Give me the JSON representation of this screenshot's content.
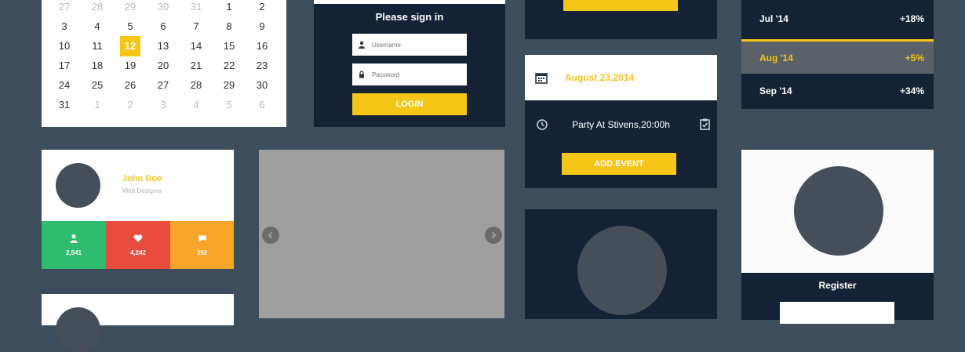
{
  "calendar": {
    "weeks": [
      [
        {
          "d": "27",
          "m": true
        },
        {
          "d": "28",
          "m": true
        },
        {
          "d": "29",
          "m": true
        },
        {
          "d": "30",
          "m": true
        },
        {
          "d": "31",
          "m": true
        },
        {
          "d": "1",
          "m": false
        },
        {
          "d": "2",
          "m": false
        }
      ],
      [
        {
          "d": "3",
          "m": false
        },
        {
          "d": "4",
          "m": false
        },
        {
          "d": "5",
          "m": false
        },
        {
          "d": "6",
          "m": false
        },
        {
          "d": "7",
          "m": false
        },
        {
          "d": "8",
          "m": false
        },
        {
          "d": "9",
          "m": false
        }
      ],
      [
        {
          "d": "10",
          "m": false
        },
        {
          "d": "11",
          "m": false
        },
        {
          "d": "12",
          "m": false,
          "today": true
        },
        {
          "d": "13",
          "m": false
        },
        {
          "d": "14",
          "m": false
        },
        {
          "d": "15",
          "m": false
        },
        {
          "d": "16",
          "m": false
        }
      ],
      [
        {
          "d": "17",
          "m": false
        },
        {
          "d": "18",
          "m": false
        },
        {
          "d": "19",
          "m": false
        },
        {
          "d": "20",
          "m": false
        },
        {
          "d": "21",
          "m": false
        },
        {
          "d": "22",
          "m": false
        },
        {
          "d": "23",
          "m": false
        }
      ],
      [
        {
          "d": "24",
          "m": false
        },
        {
          "d": "25",
          "m": false
        },
        {
          "d": "26",
          "m": false
        },
        {
          "d": "27",
          "m": false
        },
        {
          "d": "28",
          "m": false
        },
        {
          "d": "29",
          "m": false
        },
        {
          "d": "30",
          "m": false
        }
      ],
      [
        {
          "d": "31",
          "m": false
        },
        {
          "d": "1",
          "m": true
        },
        {
          "d": "2",
          "m": true
        },
        {
          "d": "3",
          "m": true
        },
        {
          "d": "4",
          "m": true
        },
        {
          "d": "5",
          "m": true
        },
        {
          "d": "6",
          "m": true
        }
      ]
    ]
  },
  "signin": {
    "title": "Please sign in",
    "username_placeholder": "Username",
    "password_placeholder": "Password",
    "login_label": "LOGIN",
    "username_icon": "user-icon",
    "password_icon": "lock-icon"
  },
  "stats": {
    "rows": [
      {
        "month": "Jul '14",
        "value": "+18%",
        "active": false
      },
      {
        "month": "Aug '14",
        "value": "+5%",
        "active": true
      },
      {
        "month": "Sep '14",
        "value": "+34%",
        "active": false
      }
    ]
  },
  "event": {
    "date": "August 23,2014",
    "title": "Party At Stivens,20:00h",
    "add_label": "ADD EVENT",
    "calendar_icon": "calendar-icon",
    "clock_icon": "clock-icon",
    "clipboard_icon": "clipboard-icon"
  },
  "profile": {
    "name": "John Doe",
    "role": "Web Designer",
    "stats": [
      {
        "icon": "user-icon",
        "value": "2,541",
        "color": "#2ebd6f"
      },
      {
        "icon": "heart-icon",
        "value": "4,242",
        "color": "#e84c3d"
      },
      {
        "icon": "comment-icon",
        "value": "392",
        "color": "#f7a62b"
      }
    ]
  },
  "slider": {
    "prev_icon": "chevron-left-icon",
    "next_icon": "chevron-right-icon"
  },
  "register": {
    "title": "Register"
  },
  "colors": {
    "accent": "#f5c518",
    "navy": "#152236",
    "background": "#3e4d5c"
  }
}
